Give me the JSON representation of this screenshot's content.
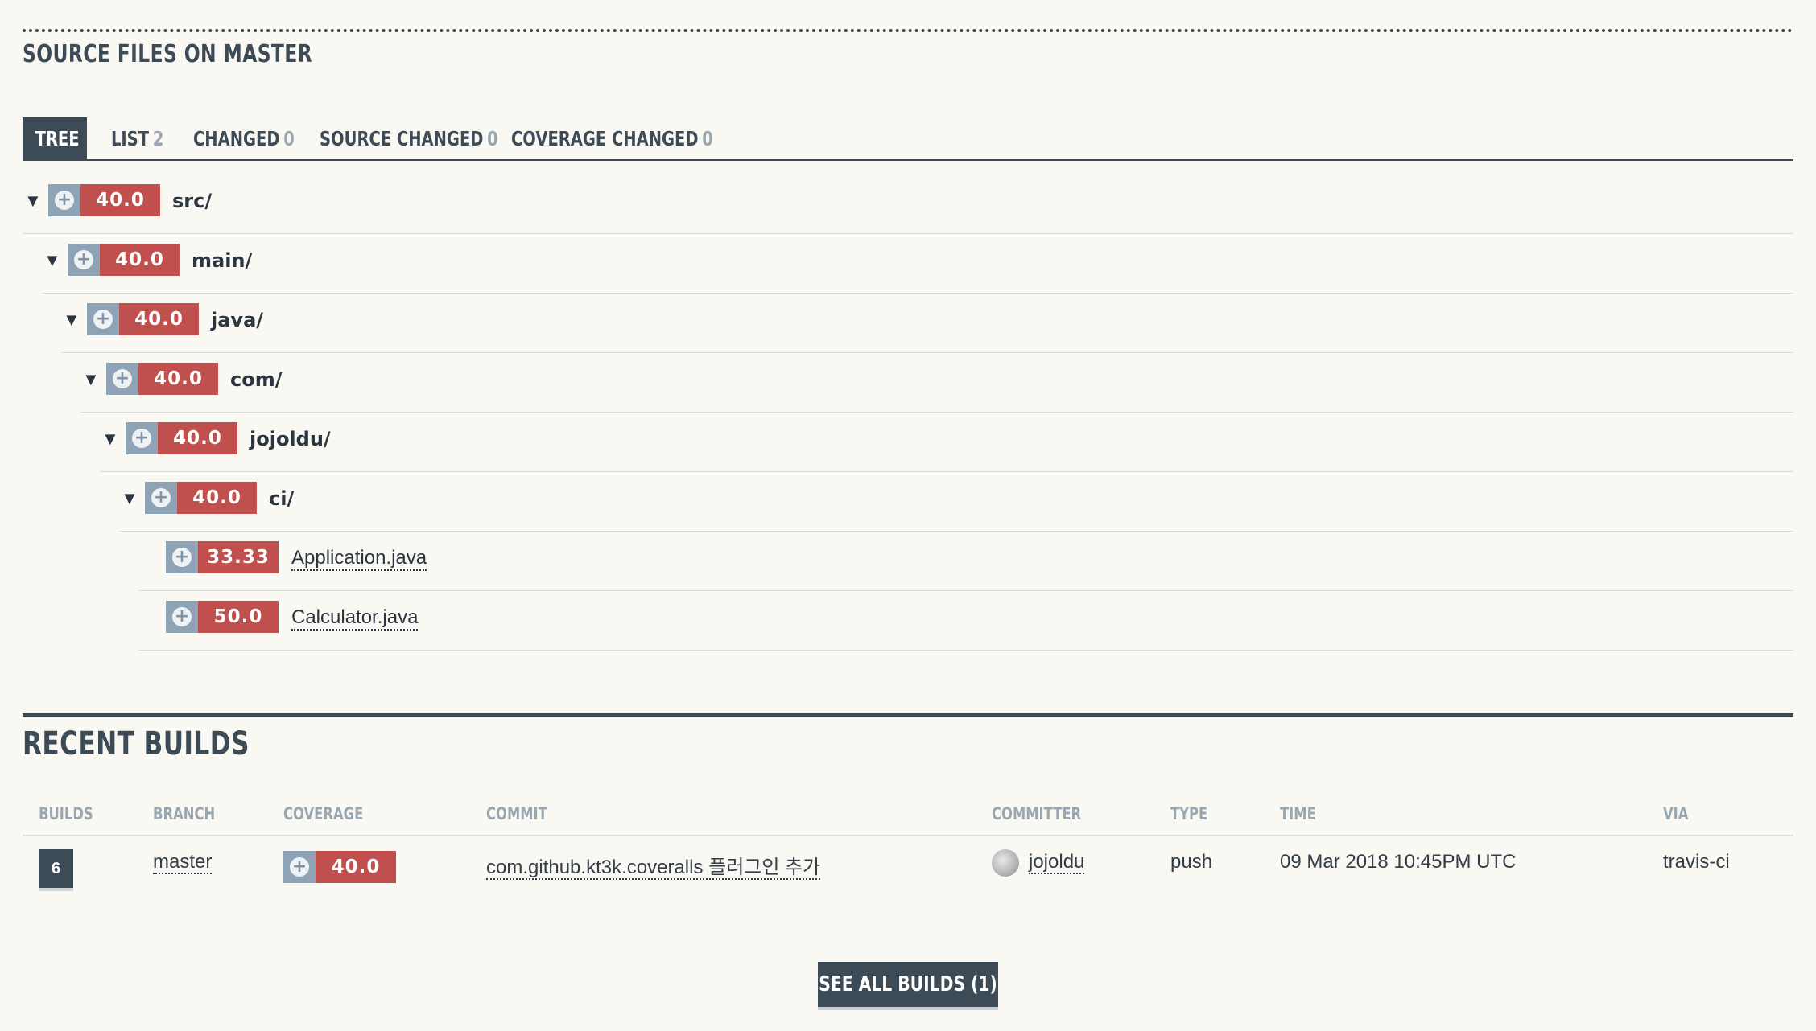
{
  "source": {
    "title": "SOURCE FILES ON MASTER",
    "tabs": [
      {
        "label": "TREE",
        "count": ""
      },
      {
        "label": "LIST",
        "count": "2"
      },
      {
        "label": "CHANGED",
        "count": "0"
      },
      {
        "label": "SOURCE CHANGED",
        "count": "0"
      },
      {
        "label": "COVERAGE CHANGED",
        "count": "0"
      }
    ],
    "tree": [
      {
        "name": "src/",
        "coverage": "40.0",
        "type": "dir"
      },
      {
        "name": "main/",
        "coverage": "40.0",
        "type": "dir"
      },
      {
        "name": "java/",
        "coverage": "40.0",
        "type": "dir"
      },
      {
        "name": "com/",
        "coverage": "40.0",
        "type": "dir"
      },
      {
        "name": "jojoldu/",
        "coverage": "40.0",
        "type": "dir"
      },
      {
        "name": "ci/",
        "coverage": "40.0",
        "type": "dir"
      },
      {
        "name": "Application.java",
        "coverage": "33.33",
        "type": "file"
      },
      {
        "name": "Calculator.java",
        "coverage": "50.0",
        "type": "file"
      }
    ],
    "expand_glyph": "▼",
    "plus_glyph": "+"
  },
  "builds": {
    "title": "RECENT BUILDS",
    "headers": [
      "BUILDS",
      "BRANCH",
      "COVERAGE",
      "COMMIT",
      "COMMITTER",
      "TYPE",
      "TIME",
      "VIA"
    ],
    "rows": [
      {
        "build": "6",
        "branch": "master",
        "coverage": "40.0",
        "commit": "com.github.kt3k.coveralls 플러그인 추가",
        "committer": "jojoldu",
        "type": "push",
        "time": "09 Mar 2018 10:45PM UTC",
        "via": "travis-ci"
      }
    ],
    "see_all_label": "SEE ALL BUILDS (1)"
  },
  "colors": {
    "accent": "#3d4b57",
    "coverage_low": "#c0504d",
    "plus_bg": "#8ea3b5",
    "background": "#f9f8f3"
  },
  "icons": {
    "expand": "triangle-down-icon",
    "add": "plus-circle-icon",
    "avatar": "user-avatar"
  }
}
